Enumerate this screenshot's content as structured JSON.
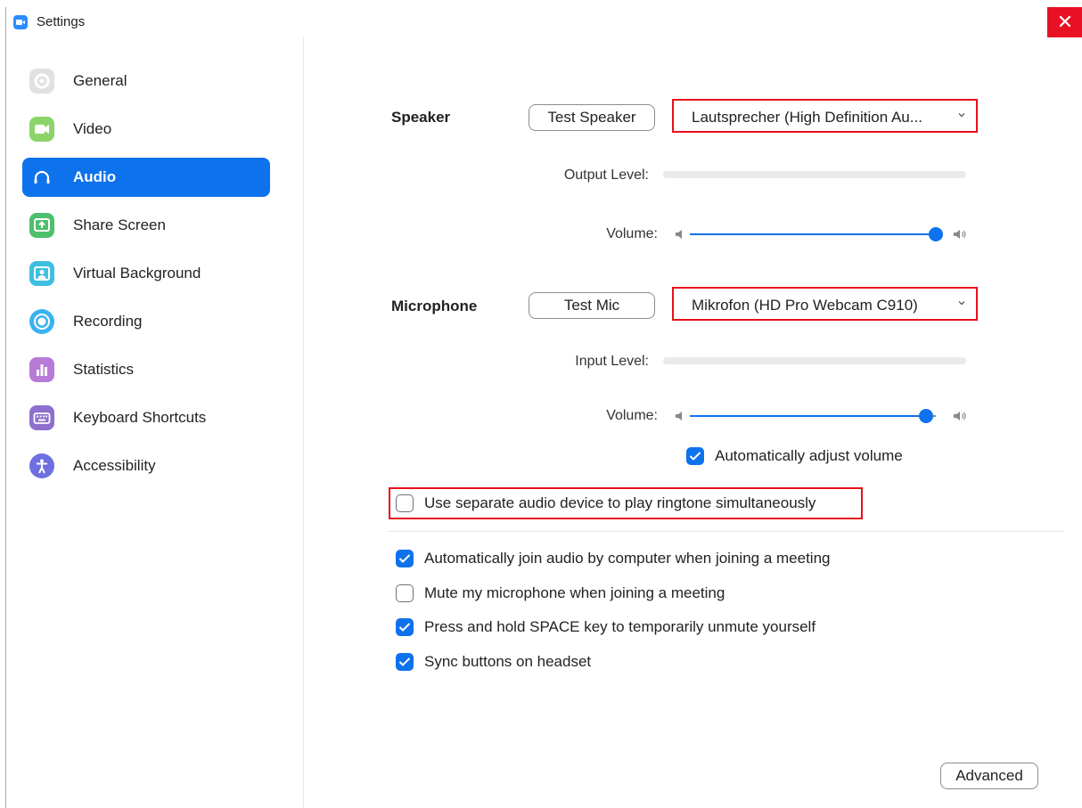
{
  "window": {
    "title": "Settings",
    "close_glyph": "✕"
  },
  "sidebar": {
    "items": [
      {
        "label": "General",
        "icon": "gear-icon",
        "color": "#e1e1e1"
      },
      {
        "label": "Video",
        "icon": "video-camera-icon",
        "color": "#8cd46a"
      },
      {
        "label": "Audio",
        "icon": "headphones-icon",
        "color": "#0e72ed",
        "active": true
      },
      {
        "label": "Share Screen",
        "icon": "share-screen-icon",
        "color": "#4ebf6c"
      },
      {
        "label": "Virtual Background",
        "icon": "person-background-icon",
        "color": "#3fbfe0"
      },
      {
        "label": "Recording",
        "icon": "record-icon",
        "color": "#3ab2f0"
      },
      {
        "label": "Statistics",
        "icon": "bar-chart-icon",
        "color": "#b77ad6"
      },
      {
        "label": "Keyboard Shortcuts",
        "icon": "keyboard-icon",
        "color": "#8e6fcf"
      },
      {
        "label": "Accessibility",
        "icon": "accessibility-icon",
        "color": "#6e70e0"
      }
    ]
  },
  "speaker": {
    "label": "Speaker",
    "test_button": "Test Speaker",
    "device": "Lautsprecher (High Definition Au...",
    "output_level_label": "Output Level:",
    "output_level": 0,
    "volume_label": "Volume:",
    "volume": 100
  },
  "microphone": {
    "label": "Microphone",
    "test_button": "Test Mic",
    "device": "Mikrofon (HD Pro Webcam C910)",
    "input_level_label": "Input Level:",
    "input_level": 0,
    "volume_label": "Volume:",
    "volume": 96,
    "auto_adjust": {
      "label": "Automatically adjust volume",
      "checked": true
    }
  },
  "separate_ringtone": {
    "label": "Use separate audio device to play ringtone simultaneously",
    "checked": false
  },
  "options": [
    {
      "label": "Automatically join audio by computer when joining a meeting",
      "checked": true
    },
    {
      "label": "Mute my microphone when joining a meeting",
      "checked": false
    },
    {
      "label": "Press and hold SPACE key to temporarily unmute yourself",
      "checked": true
    },
    {
      "label": "Sync buttons on headset",
      "checked": true
    }
  ],
  "advanced_button": "Advanced",
  "colors": {
    "accent": "#0e72ed",
    "highlight_box": "#e8101c",
    "close": "#e81123"
  }
}
